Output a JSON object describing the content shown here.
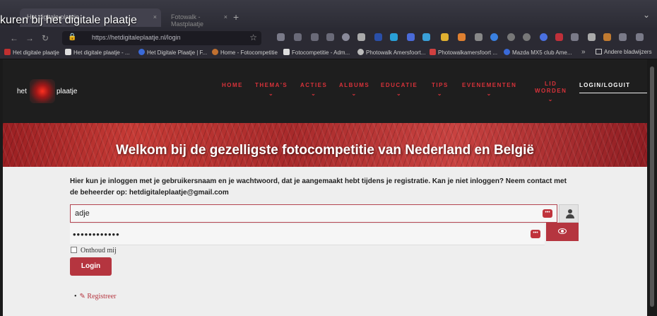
{
  "video_title": "kuren bij het digitale plaatje",
  "browser": {
    "tabs": [
      {
        "label": "Het digitale plaatje",
        "close": "×"
      },
      {
        "label": "Fotowalk - Mastplaatje",
        "close": "×"
      }
    ],
    "new_tab": "+",
    "url": "https://hetdigitaleplaatje.nl/login",
    "nav": {
      "back": "←",
      "forward": "→",
      "reload": "↻"
    },
    "bookmarks": [
      "Het digitale plaatje",
      "Het digitale plaatje - ...",
      "Het Digitale Plaatje | F...",
      "Home - Fotocompetitie",
      "Fotocompetitie - Adm...",
      "Photowalk Amersfoort...",
      "Photowalkamersfoort ...",
      "Mazda MX5 club Ame..."
    ],
    "bookmarks_more": "»",
    "other_bookmarks": "Andere bladwijzers"
  },
  "site": {
    "logo": {
      "left": "het",
      "right": "plaatje"
    },
    "menu": [
      "HOME",
      "THEMA'S",
      "ACTIES",
      "ALBUMS",
      "EDUCATIE",
      "TIPS",
      "EVENEMENTEN"
    ],
    "menu_lid": [
      "LID",
      "WORDEN"
    ],
    "login_link": "LOGIN/LOGUIT",
    "chevron": "⌄",
    "banner_title": "Welkom bij de gezelligste fotocompetitie van Nederland en België"
  },
  "login": {
    "intro": "Hier kun je inloggen met je gebruikersnaam en je wachtwoord, dat je aangemaakt hebt tijdens je registratie. Kan je niet inloggen? Neem contact met de beheerder op: hetdigitaleplaatje@gmail.com",
    "username_value": "adje",
    "password_value": "••••••••••••",
    "pm_icon": "•••",
    "remember_label": "Onthoud mij",
    "submit_label": "Login",
    "register_label": "Registreer",
    "register_icon": "✎",
    "bullet": "•"
  },
  "colors": {
    "accent": "#b5353f",
    "header": "#1e1e1e",
    "content_bg": "#eeeeee"
  }
}
